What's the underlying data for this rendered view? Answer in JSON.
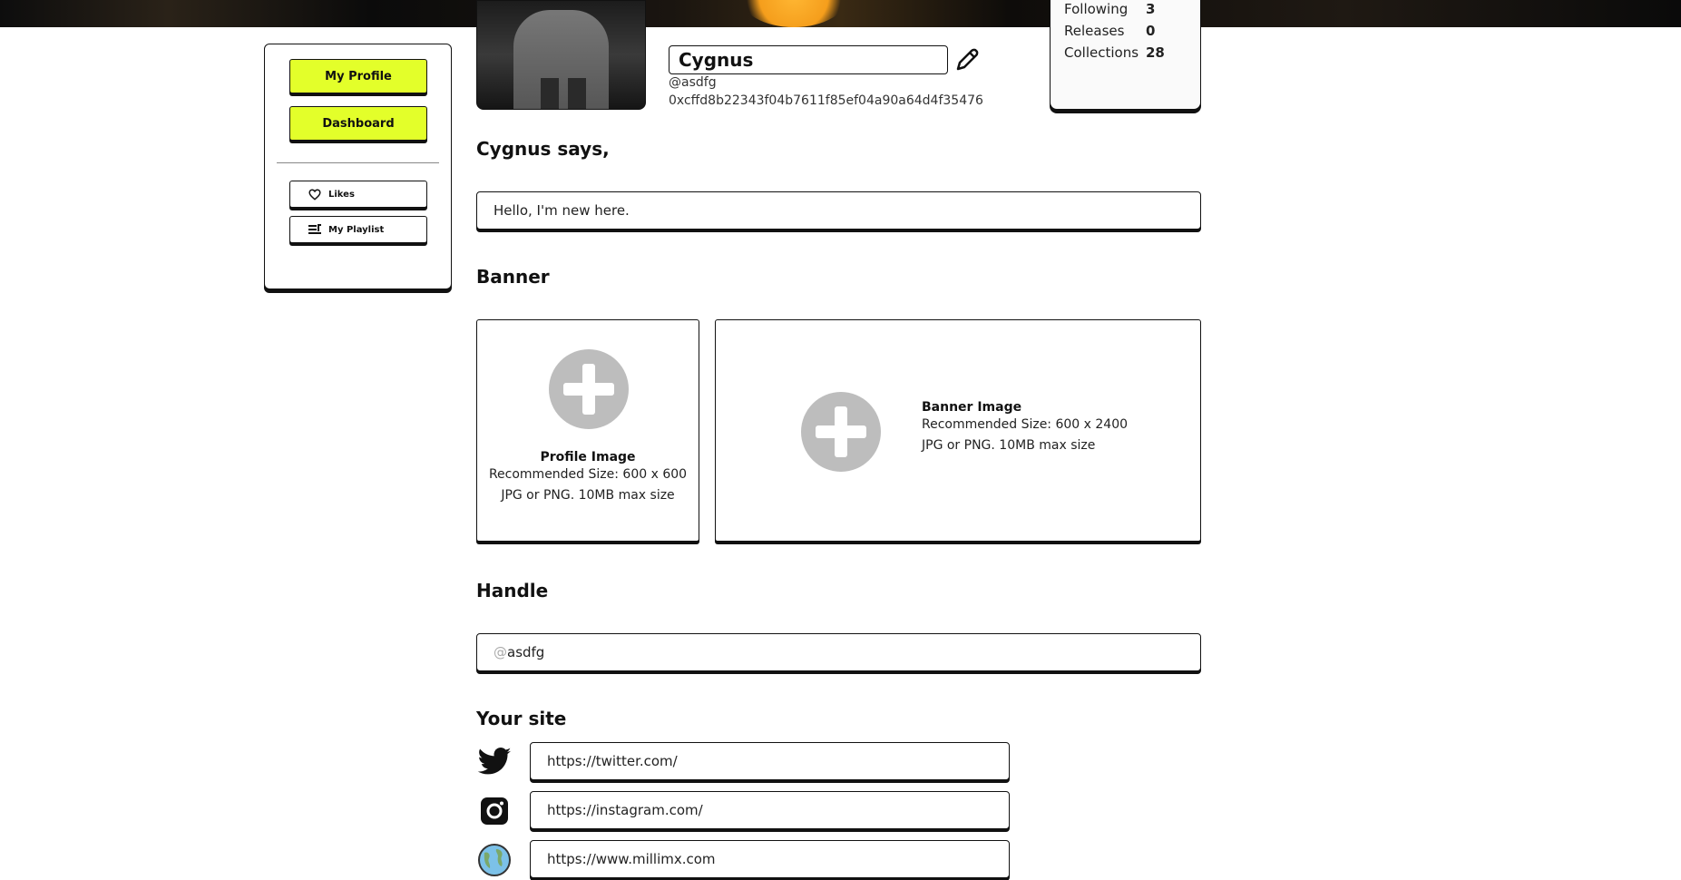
{
  "sidebar": {
    "my_profile": "My Profile",
    "dashboard": "Dashboard",
    "likes": "Likes",
    "playlist": "My Playlist"
  },
  "profile": {
    "name": "Cygnus",
    "handle": "@asdfg",
    "address": "0xcffd8b22343f04b7611f85ef04a90a64d4f35476"
  },
  "stats": [
    {
      "label": "Following",
      "value": "3"
    },
    {
      "label": "Releases",
      "value": "0"
    },
    {
      "label": "Collections",
      "value": "28"
    }
  ],
  "says": {
    "heading": "Cygnus says,",
    "value": "Hello, I'm new here."
  },
  "banner": {
    "heading": "Banner",
    "profile_title": "Profile Image",
    "profile_size": "Recommended Size: 600 x 600",
    "profile_format": "JPG or PNG. 10MB max size",
    "banner_title": "Banner Image",
    "banner_size": "Recommended Size: 600 x 2400",
    "banner_format": "JPG or PNG. 10MB max size"
  },
  "handle": {
    "heading": "Handle",
    "prefix": "@",
    "value": "asdfg"
  },
  "site": {
    "heading": "Your site",
    "twitter": "https://twitter.com/",
    "instagram": "https://instagram.com/",
    "website": "https://www.millimx.com"
  },
  "colors": {
    "accent": "#e3ff2a",
    "upload_placeholder": "#bdbdbd"
  }
}
